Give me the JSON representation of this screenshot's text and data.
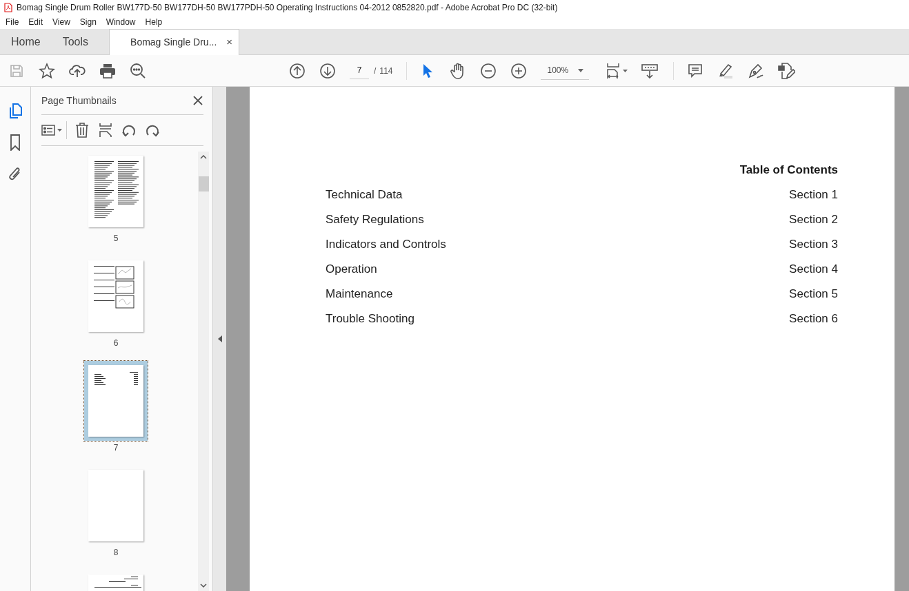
{
  "window": {
    "title": "Bomag Single Drum Roller BW177D-50 BW177DH-50 BW177PDH-50 Operating Instructions 04-2012 0852820.pdf - Adobe Acrobat Pro DC (32-bit)"
  },
  "menu": [
    "File",
    "Edit",
    "View",
    "Sign",
    "Window",
    "Help"
  ],
  "tabs": [
    {
      "label": "Home",
      "selected": false,
      "kind": "nav"
    },
    {
      "label": "Tools",
      "selected": false,
      "kind": "nav"
    },
    {
      "label": "Bomag Single Dru...",
      "selected": true,
      "kind": "document",
      "close": "×"
    }
  ],
  "toolbar": {
    "page_current": "7",
    "page_separator": "/",
    "page_total": "114",
    "zoom": "100%",
    "tools": [
      {
        "kind": "pointer",
        "selected": true
      },
      {
        "kind": "hand",
        "selected": false
      }
    ]
  },
  "rail": [
    {
      "kind": "pages",
      "selected": true
    },
    {
      "kind": "bookmark",
      "selected": false
    },
    {
      "kind": "attachment",
      "selected": false
    }
  ],
  "sidebar": {
    "title": "Page Thumbnails",
    "thumbnails": [
      {
        "label": "5",
        "kind": "columns",
        "selected": false
      },
      {
        "label": "6",
        "kind": "figures",
        "selected": false
      },
      {
        "label": "7",
        "kind": "toc",
        "selected": true
      },
      {
        "label": "8",
        "kind": "blank",
        "selected": false
      },
      {
        "kind": "heading",
        "selected": false
      }
    ]
  },
  "document": {
    "heading": "Table of Contents",
    "entries": [
      {
        "title": "Technical Data",
        "section": "Section 1"
      },
      {
        "title": "Safety Regulations",
        "section": "Section 2"
      },
      {
        "title": "Indicators and Controls",
        "section": "Section 3"
      },
      {
        "title": "Operation",
        "section": "Section 4"
      },
      {
        "title": "Maintenance",
        "section": "Section 5"
      },
      {
        "title": "Trouble Shooting",
        "section": "Section 6"
      }
    ]
  }
}
